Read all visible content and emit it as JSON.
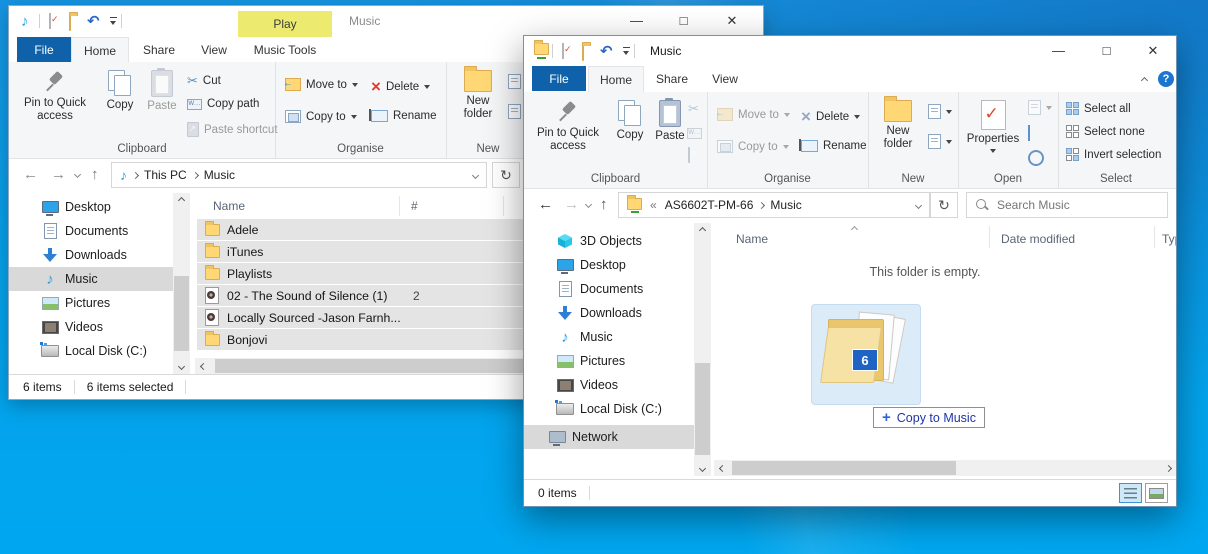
{
  "colors": {
    "file_tab_blue": "#0f62a9",
    "play_tab_yellow": "#edeb6f",
    "selection_gray": "#e4e4e4",
    "badge_blue": "#1f63c4",
    "desktop_blue": "#00a7f0",
    "help_blue": "#1c76d1"
  },
  "back_window": {
    "title": "Music",
    "contextual_header": "Play",
    "tabs": {
      "file": "File",
      "home": "Home",
      "share": "Share",
      "view": "View",
      "music_tools": "Music Tools"
    },
    "ribbon": {
      "pin": "Pin to Quick access",
      "copy": "Copy",
      "paste": "Paste",
      "cut": "Cut",
      "copy_path": "Copy path",
      "paste_shortcut": "Paste shortcut",
      "clipboard_label": "Clipboard",
      "move_to": "Move to",
      "copy_to": "Copy to",
      "delete": "Delete",
      "rename": "Rename",
      "organise_label": "Organise",
      "new_folder": "New folder",
      "new_label": "New"
    },
    "address": {
      "crumb1": "This PC",
      "crumb2": "Music"
    },
    "sidebar": [
      "Desktop",
      "Documents",
      "Downloads",
      "Music",
      "Pictures",
      "Videos",
      "Local Disk (C:)"
    ],
    "columns": {
      "name": "Name",
      "num": "#"
    },
    "rows": [
      {
        "name": "Adele",
        "num": ""
      },
      {
        "name": "iTunes",
        "num": ""
      },
      {
        "name": "Playlists",
        "num": ""
      },
      {
        "name": "02 - The Sound of Silence (1)",
        "num": "2"
      },
      {
        "name": "Locally Sourced -Jason Farnh...",
        "num": ""
      },
      {
        "name": "Bonjovi",
        "num": ""
      }
    ],
    "status": {
      "count": "6 items",
      "selected": "6 items selected"
    }
  },
  "front_window": {
    "title": "Music",
    "tabs": {
      "file": "File",
      "home": "Home",
      "share": "Share",
      "view": "View"
    },
    "ribbon": {
      "pin": "Pin to Quick access",
      "copy": "Copy",
      "paste": "Paste",
      "clipboard_label": "Clipboard",
      "move_to": "Move to",
      "copy_to": "Copy to",
      "delete": "Delete",
      "rename": "Rename",
      "organise_label": "Organise",
      "new_folder": "New folder",
      "new_label": "New",
      "properties": "Properties",
      "open_label": "Open",
      "select_all": "Select all",
      "select_none": "Select none",
      "invert_selection": "Invert selection",
      "select_label": "Select"
    },
    "address": {
      "prefix": "«",
      "crumb1": "AS6602T-PM-66",
      "crumb2": "Music"
    },
    "search_placeholder": "Search Music",
    "sidebar": [
      "3D Objects",
      "Desktop",
      "Documents",
      "Downloads",
      "Music",
      "Pictures",
      "Videos",
      "Local Disk (C:)",
      "Network"
    ],
    "columns": {
      "name": "Name",
      "date": "Date modified",
      "type": "Type"
    },
    "empty_text": "This folder is empty.",
    "drag": {
      "badge": "6",
      "plus": "+",
      "tooltip": "Copy to Music"
    },
    "status": {
      "count": "0 items"
    }
  }
}
